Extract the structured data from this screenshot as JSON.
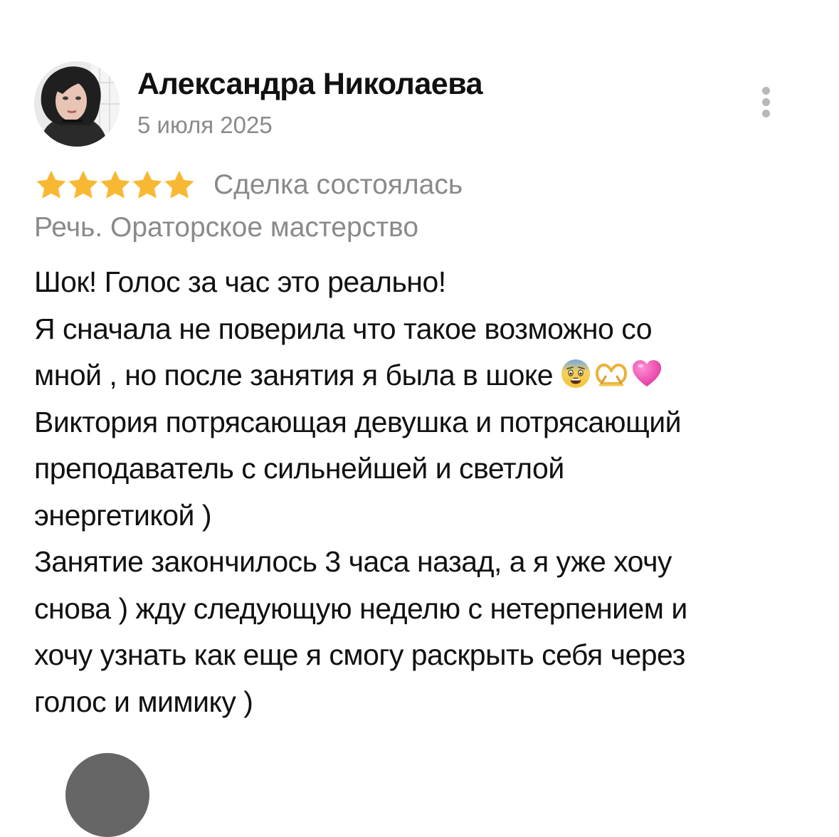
{
  "review": {
    "author": {
      "name": "Александра Николаева",
      "avatar_icon": "user-avatar-photo"
    },
    "date": "5 июля 2025",
    "menu_icon": "more-vertical-icon",
    "rating": 5,
    "rating_max": 5,
    "star_color": "#F8B833",
    "deal_status": "Сделка состоялась",
    "service": "Речь. Ораторское мастерство",
    "text_lines": [
      "Шок! Голос за час это реально!",
      "Я сначала не поверила что такое возможно со",
      "мной , но после занятия я была в шоке",
      "Виктория потрясающая девушка и потрясающий",
      "преподаватель с сильнейшей и светлой",
      "энергетикой )",
      "Занятие закончилось 3 часа назад, а я уже хочу",
      "снова ) жду следующую неделю с нетерпением и",
      "хочу узнать как еще я смогу раскрыть себя через",
      "голос и мимику )"
    ],
    "emojis": [
      "fearful-face-emoji",
      "heart-hands-emoji",
      "pink-heart-emoji"
    ]
  },
  "next_review": {
    "avatar_icon": "user-avatar-photo"
  }
}
